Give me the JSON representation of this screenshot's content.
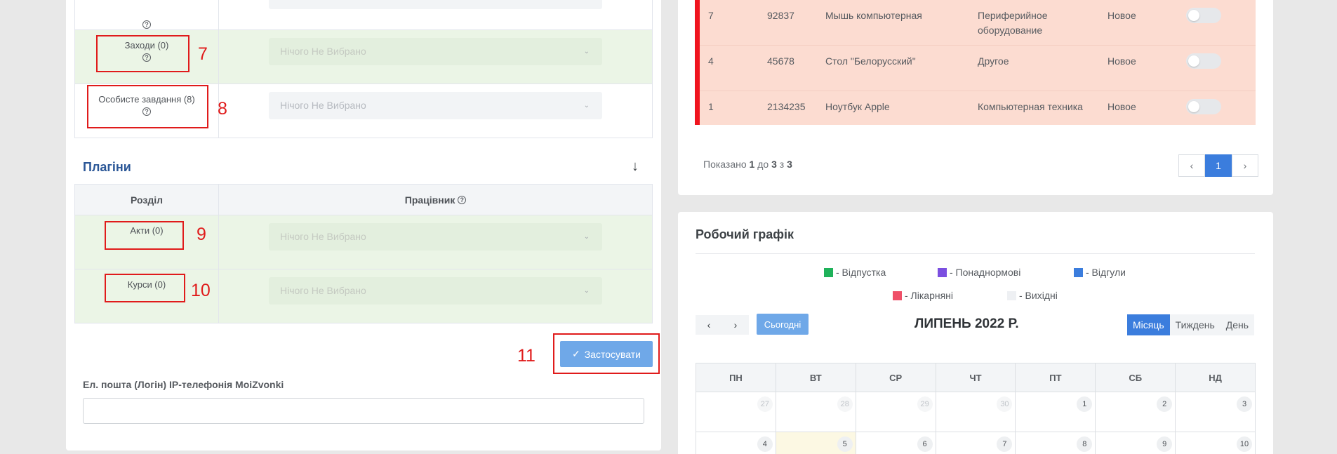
{
  "left": {
    "rows": [
      {
        "label": "Заходи (0)",
        "select": "Нічого Не Вибрано",
        "num": "7"
      },
      {
        "label": "Особисте завдання (8)",
        "select": "Нічого Не Вибрано",
        "num": "8"
      }
    ],
    "plugins_title": "Плагіни",
    "plugins_header": {
      "section": "Розділ",
      "employee": "Працівник"
    },
    "plugin_rows": [
      {
        "label": "Акти (0)",
        "select": "Нічого Не Вибрано",
        "num": "9"
      },
      {
        "label": "Курси (0)",
        "select": "Нічого Не Вибрано",
        "num": "10"
      }
    ],
    "apply_label": "Застосувати",
    "apply_num": "11",
    "email_label": "Ел. пошта (Логін) IP-телефонія MoiZvonki"
  },
  "orders": {
    "rows": [
      {
        "n": "7",
        "code": "92837",
        "name": "Мышь компьютерная",
        "category": "Периферийное оборудование",
        "status": "Новое"
      },
      {
        "n": "4",
        "code": "45678",
        "name": "Стол \"Белорусский\"",
        "category": "Другое",
        "status": "Новое"
      },
      {
        "n": "1",
        "code": "2134235",
        "name": "Ноутбук Apple",
        "category": "Компьютерная техника",
        "status": "Новое"
      }
    ],
    "shown_prefix": "Показано ",
    "shown_from": "1",
    "shown_mid1": " до ",
    "shown_to": "3",
    "shown_mid2": " з ",
    "shown_total": "3",
    "page": "1"
  },
  "schedule": {
    "title": "Робочий графік",
    "legend": [
      {
        "label": "- Відпустка",
        "color": "#1fb25a"
      },
      {
        "label": "- Понаднормові",
        "color": "#7b4fe0"
      },
      {
        "label": "- Відгули",
        "color": "#3b7ddd"
      },
      {
        "label": "- Лікарняні",
        "color": "#ef5068"
      },
      {
        "label": "- Вихідні",
        "color": "#eef0f3"
      }
    ],
    "today_label": "Сьогодні",
    "month_title": "ЛИПЕНЬ 2022 Р.",
    "views": [
      "Місяць",
      "Тиждень",
      "День"
    ],
    "weekdays": [
      "ПН",
      "ВТ",
      "СР",
      "ЧТ",
      "ПТ",
      "СБ",
      "НД"
    ],
    "week1": [
      "27",
      "28",
      "29",
      "30",
      "1",
      "2",
      "3"
    ],
    "week2": [
      "4",
      "5",
      "6",
      "7",
      "8",
      "9",
      "10"
    ]
  }
}
